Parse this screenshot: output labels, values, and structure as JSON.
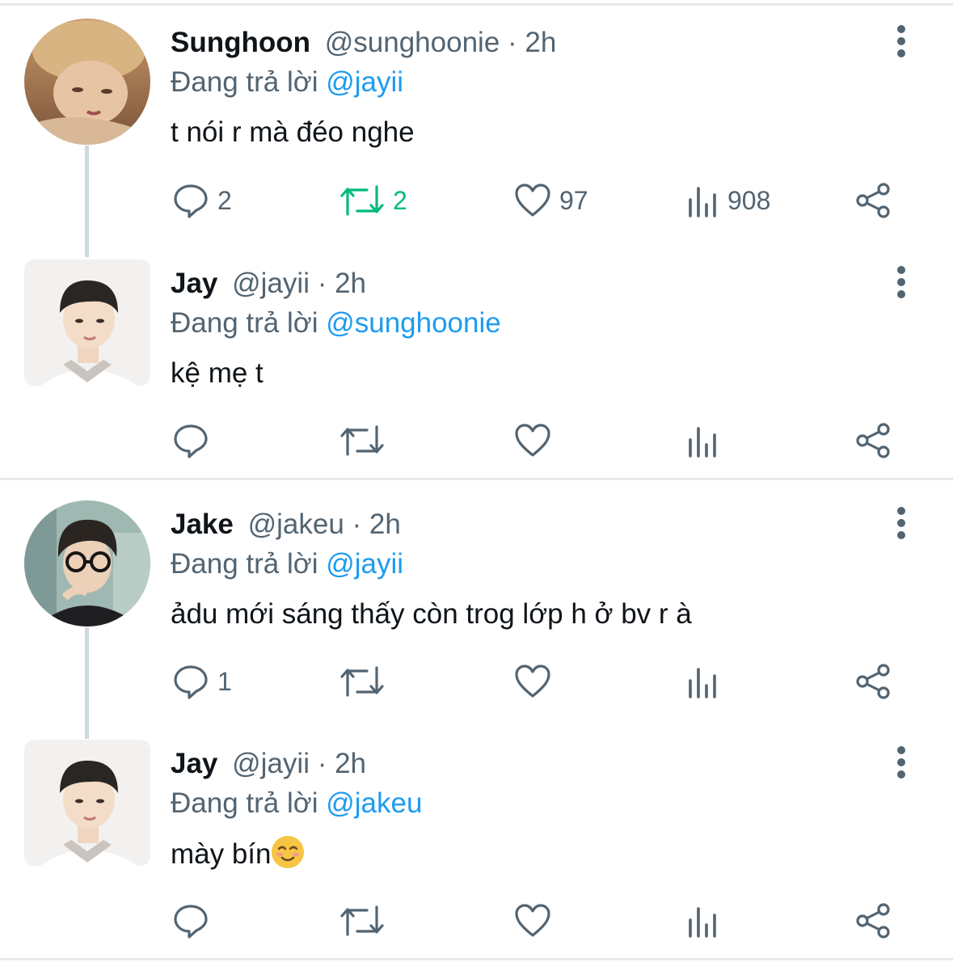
{
  "colors": {
    "accent": "#1d9bf0",
    "text": "#0f1419",
    "muted": "#536471",
    "retweet_active": "#00ba7c",
    "divider": "#e6e9ec",
    "thread_line": "#cfd9de"
  },
  "threads": [
    {
      "tweets": [
        {
          "display_name": "Sunghoon",
          "handle": "@sunghoonie",
          "time": "· 2h",
          "reply_prefix": "Đang trả lời",
          "reply_to": "@jayii",
          "text": "t nói r mà đéo nghe",
          "avatar_icon": "avatar-sunghoon",
          "stats": {
            "replies": "2",
            "retweets": "2",
            "likes": "97",
            "views": "908"
          },
          "retweeted": true
        },
        {
          "display_name": "Jay",
          "handle": "@jayii",
          "time": "· 2h",
          "reply_prefix": "Đang trả lời",
          "reply_to": "@sunghoonie",
          "text": "kệ mẹ t",
          "avatar_icon": "avatar-jay",
          "stats": {
            "replies": "",
            "retweets": "",
            "likes": "",
            "views": ""
          },
          "retweeted": false
        }
      ]
    },
    {
      "tweets": [
        {
          "display_name": "Jake",
          "handle": "@jakeu",
          "time": "· 2h",
          "reply_prefix": "Đang trả lời",
          "reply_to": "@jayii",
          "text": "ảdu mới sáng thấy còn trog lớp h ở bv r à",
          "avatar_icon": "avatar-jake",
          "stats": {
            "replies": "1",
            "retweets": "",
            "likes": "",
            "views": ""
          },
          "retweeted": false
        },
        {
          "display_name": "Jay",
          "handle": "@jayii",
          "time": "· 2h",
          "reply_prefix": "Đang trả lời",
          "reply_to": "@jakeu",
          "text": "mày bín",
          "emoji": "smiling-face-icon",
          "avatar_icon": "avatar-jay",
          "stats": {
            "replies": "",
            "retweets": "",
            "likes": "",
            "views": ""
          },
          "retweeted": false
        }
      ]
    }
  ]
}
